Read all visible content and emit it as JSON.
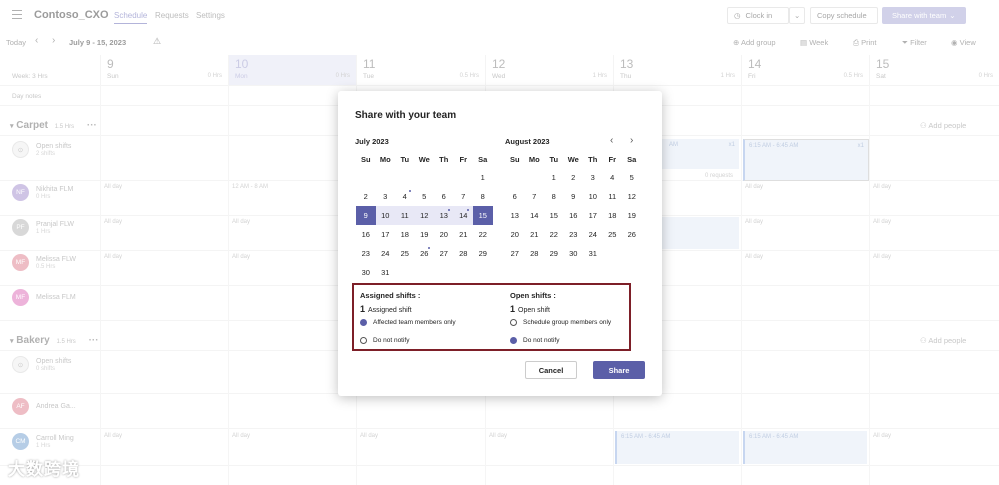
{
  "header": {
    "team_name": "Contoso_CXO",
    "tabs": [
      {
        "label": "Schedule"
      },
      {
        "label": "Requests"
      },
      {
        "label": "Settings"
      }
    ],
    "clock_in": "Clock in",
    "copy_schedule": "Copy schedule",
    "share_with_team": "Share with team"
  },
  "toolbar": {
    "today": "Today",
    "date_range": "July 9 - 15, 2023",
    "add_group": "Add group",
    "week": "Week",
    "print": "Print",
    "filter": "Filter",
    "view": "View"
  },
  "week_label": "Week: 3 Hrs",
  "day_notes": "Day notes",
  "days": [
    {
      "num": "9",
      "name": "Sun",
      "hrs": "0 Hrs"
    },
    {
      "num": "10",
      "name": "Mon",
      "hrs": "0 Hrs"
    },
    {
      "num": "11",
      "name": "Tue",
      "hrs": "0.5 Hrs"
    },
    {
      "num": "12",
      "name": "Wed",
      "hrs": "1 Hrs"
    },
    {
      "num": "13",
      "name": "Thu",
      "hrs": "1 Hrs"
    },
    {
      "num": "14",
      "name": "Fri",
      "hrs": "0.5 Hrs"
    },
    {
      "num": "15",
      "name": "Sat",
      "hrs": "0 Hrs"
    }
  ],
  "groups": {
    "carpet": {
      "name": "Carpet",
      "hrs": "1.5 Hrs",
      "add_people": "Add people"
    },
    "bakery": {
      "name": "Bakery",
      "hrs": "1.5 Hrs",
      "add_people": "Add people"
    }
  },
  "members": [
    {
      "initials": "",
      "name": "Open shifts",
      "hrs": "2 shifts"
    },
    {
      "initials": "NF",
      "name": "Nikhita FLM",
      "hrs": "0 Hrs"
    },
    {
      "initials": "PF",
      "name": "Pranjal FLW",
      "hrs": "1 Hrs"
    },
    {
      "initials": "MF",
      "name": "Melissa FLW",
      "hrs": "0.5 Hrs"
    },
    {
      "initials": "MF",
      "name": "Melissa FLM",
      "hrs": ""
    },
    {
      "initials": "",
      "name": "Open shifts",
      "hrs": "0 shifts"
    },
    {
      "initials": "AF",
      "name": "Andrea Ga...",
      "hrs": ""
    },
    {
      "initials": "CM",
      "name": "Carroll Ming",
      "hrs": "1 Hrs"
    }
  ],
  "cells": {
    "all_day": "All day",
    "shift_1": "12 AM - 8 AM",
    "shift_2": "6:15 AM - 6:45 AM",
    "shift_3": "6:15 AM - 6:45 AM",
    "requests": "0 requests",
    "x1": "x1",
    "am": "AM"
  },
  "dialog": {
    "title": "Share with your team",
    "month1": "July 2023",
    "month2": "August 2023",
    "weekdays": [
      "Su",
      "Mo",
      "Tu",
      "We",
      "Th",
      "Fr",
      "Sa"
    ],
    "july": [
      "",
      "",
      "",
      "",
      "",
      "",
      "1",
      "2",
      "3",
      "4",
      "5",
      "6",
      "7",
      "8",
      "9",
      "10",
      "11",
      "12",
      "13",
      "14",
      "15",
      "16",
      "17",
      "18",
      "19",
      "20",
      "21",
      "22",
      "23",
      "24",
      "25",
      "26",
      "27",
      "28",
      "29",
      "30",
      "31"
    ],
    "august": [
      "",
      "",
      "1",
      "2",
      "3",
      "4",
      "5",
      "6",
      "7",
      "8",
      "9",
      "10",
      "11",
      "12",
      "13",
      "14",
      "15",
      "16",
      "17",
      "18",
      "19",
      "20",
      "21",
      "22",
      "23",
      "24",
      "25",
      "26",
      "27",
      "28",
      "29",
      "30",
      "31"
    ],
    "assigned_title": "Assigned shifts :",
    "assigned_count": "1",
    "assigned_label": "Assigned shift",
    "open_title": "Open shifts :",
    "open_count": "1",
    "open_label": "Open shift",
    "opt_affected": "Affected team members only",
    "opt_do_not_notify": "Do not notify",
    "opt_schedule_group": "Schedule group members only",
    "cancel": "Cancel",
    "share": "Share"
  },
  "watermark": "大数跨境",
  "colors": {
    "accent": "#5b5fa8",
    "highlight_box": "#7d1f28"
  }
}
